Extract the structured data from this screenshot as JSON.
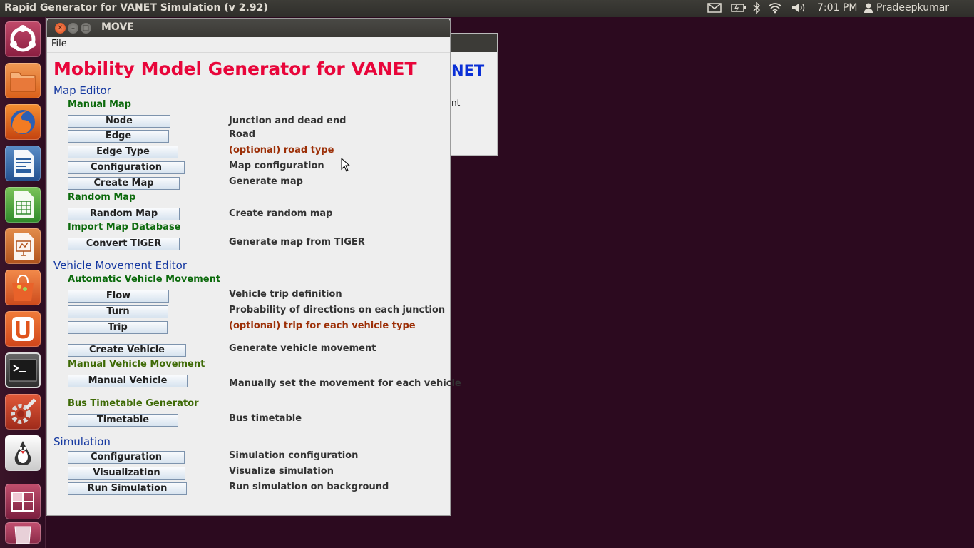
{
  "top_panel": {
    "title": "Rapid Generator for VANET Simulation (v 2.92)",
    "clock": "7:01 PM",
    "user": "Pradeepkumar"
  },
  "launcher": {
    "items": [
      "dash-icon",
      "files-icon",
      "firefox-icon",
      "writer-icon",
      "calc-icon",
      "impress-icon",
      "software-center-icon",
      "ubuntu-one-icon",
      "terminal-icon",
      "settings-icon",
      "java-icon",
      "workspace-switcher-icon",
      "trash-icon"
    ]
  },
  "bg_window": {
    "heading_fragment": "NET",
    "text_fragment": "nt"
  },
  "window": {
    "title": "MOVE",
    "menu_file": "File",
    "heading": "Mobility Model Generator for VANET"
  },
  "map_editor": {
    "title": "Map Editor",
    "manual_map": "Manual Map",
    "node": {
      "btn": "Node",
      "desc": "Junction and dead end"
    },
    "edge": {
      "btn": "Edge",
      "desc": "Road"
    },
    "edge_type": {
      "btn": "Edge Type",
      "desc": "(optional) road type"
    },
    "configuration": {
      "btn": "Configuration",
      "desc": "Map configuration"
    },
    "create_map": {
      "btn": "Create Map",
      "desc": "Generate map"
    },
    "random_map_label": "Random Map",
    "random_map": {
      "btn": "Random Map",
      "desc": "Create random map"
    },
    "import_label": "Import  Map Database",
    "convert_tiger": {
      "btn": "Convert TIGER",
      "desc": "Generate map from TIGER"
    }
  },
  "vehicle_editor": {
    "title": "Vehicle Movement Editor",
    "auto_label": "Automatic Vehicle Movement",
    "flow": {
      "btn": "Flow",
      "desc": "Vehicle trip definition"
    },
    "turn": {
      "btn": "Turn",
      "desc": "Probability of directions on each junction"
    },
    "trip": {
      "btn": "Trip",
      "desc": "(optional) trip for each vehicle type"
    },
    "create_vehicle": {
      "btn": "Create Vehicle",
      "desc": "Generate vehicle movement"
    },
    "manual_label": "Manual Vehicle Movement",
    "manual_vehicle": {
      "btn": "Manual Vehicle",
      "desc": "Manually set the movement for each vehicle"
    },
    "bus_label": "Bus Timetable Generator",
    "timetable": {
      "btn": "Timetable",
      "desc": "Bus timetable"
    }
  },
  "simulation": {
    "title": "Simulation",
    "configuration": {
      "btn": "Configuration",
      "desc": "Simulation configuration"
    },
    "visualization": {
      "btn": "Visualization",
      "desc": "Visualize simulation"
    },
    "run": {
      "btn": "Run Simulation",
      "desc": "Run simulation on background"
    }
  }
}
